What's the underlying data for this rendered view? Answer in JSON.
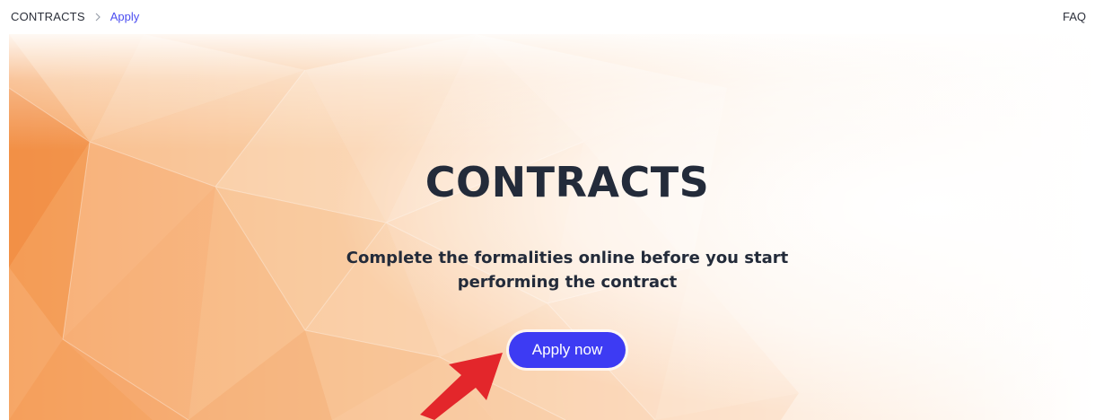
{
  "breadcrumb": {
    "root": "CONTRACTS",
    "current": "Apply"
  },
  "header": {
    "faq_label": "FAQ"
  },
  "hero": {
    "title": "CONTRACTS",
    "subtitle": "Complete the formalities online before you start performing the contract",
    "button_label": "Apply now"
  },
  "colors": {
    "accent": "#3d3bf3",
    "breadcrumb_active": "#4b4df0",
    "heading": "#232b3a",
    "annotation_arrow": "#e3262b"
  },
  "icons": {
    "breadcrumb_separator": "chevron-right-icon",
    "annotation": "red-arrow-icon"
  }
}
